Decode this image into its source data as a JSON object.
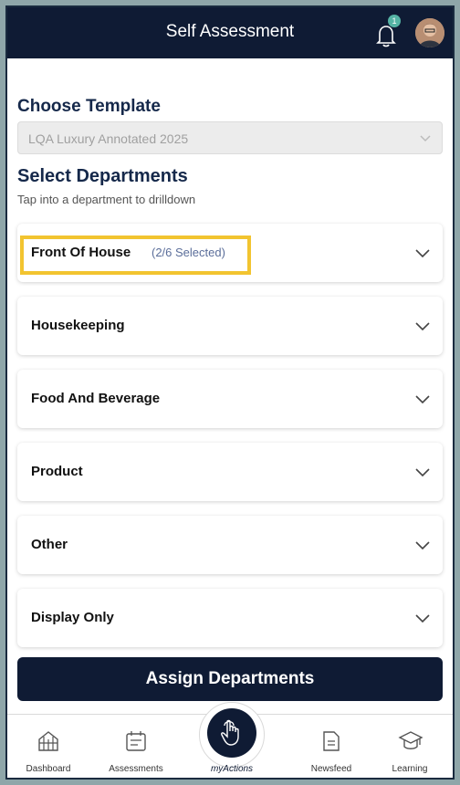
{
  "header": {
    "title": "Self Assessment",
    "notification_count": "1"
  },
  "template": {
    "heading": "Choose Template",
    "selected": "LQA Luxury Annotated 2025"
  },
  "departments": {
    "heading": "Select Departments",
    "hint": "Tap into a department to drilldown",
    "items": [
      {
        "label": "Front Of House",
        "count": "(2/6 Selected)"
      },
      {
        "label": "Housekeeping"
      },
      {
        "label": "Food And Beverage"
      },
      {
        "label": "Product"
      },
      {
        "label": "Other"
      },
      {
        "label": "Display Only"
      }
    ]
  },
  "assign_label": "Assign Departments",
  "nav": {
    "dashboard": "Dashboard",
    "assessments": "Assessments",
    "myactions": "myActions",
    "newsfeed": "Newsfeed",
    "learning": "Learning"
  },
  "colors": {
    "primary": "#0f1b34",
    "highlight": "#f2c430",
    "badge": "#55b3a4"
  }
}
